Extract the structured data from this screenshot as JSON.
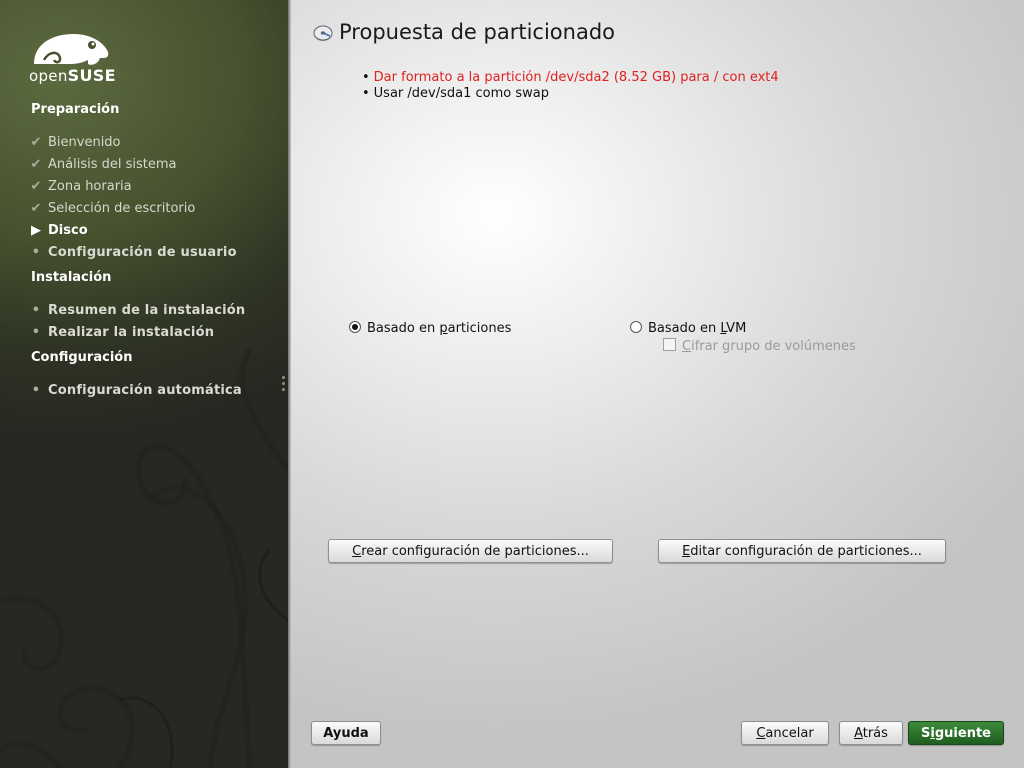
{
  "brand": {
    "logo_text_light": "open",
    "logo_text_bold": "SUSE"
  },
  "sidebar": {
    "sections": [
      {
        "title": "Preparación"
      },
      {
        "title": "Instalación"
      },
      {
        "title": "Configuración"
      }
    ],
    "steps": [
      {
        "label": "Bienvenido",
        "state": "done"
      },
      {
        "label": "Análisis del sistema",
        "state": "done"
      },
      {
        "label": "Zona horaria",
        "state": "done"
      },
      {
        "label": "Selección de escritorio",
        "state": "done"
      },
      {
        "label": "Disco",
        "state": "active"
      },
      {
        "label": "Configuración de usuario",
        "state": "pending"
      },
      {
        "label": "Resumen de la instalación",
        "state": "pending"
      },
      {
        "label": "Realizar la instalación",
        "state": "pending"
      },
      {
        "label": "Configuración automática",
        "state": "pending"
      }
    ]
  },
  "main": {
    "title": "Propuesta de particionado",
    "proposal": [
      {
        "text": "Dar formato a la partición /dev/sda2 (8.52 GB) para / con ext4",
        "color": "#e02020"
      },
      {
        "text": "Usar /dev/sda1 como swap",
        "color": "#111111"
      }
    ],
    "radio_partitions": {
      "before": "Basado en ",
      "key": "p",
      "after": "articiones",
      "selected": true
    },
    "radio_lvm": {
      "before": "Basado en ",
      "key": "L",
      "after": "VM",
      "selected": false
    },
    "check_encrypt": {
      "key": "C",
      "after": "ifrar grupo de volúmenes",
      "checked": false,
      "enabled": false
    },
    "btn_create": {
      "key": "C",
      "after": "rear configuración de particiones..."
    },
    "btn_edit": {
      "key": "E",
      "after": "ditar configuración de particiones..."
    }
  },
  "footer": {
    "help": "Ayuda",
    "cancel": {
      "key": "C",
      "after": "ancelar"
    },
    "back": {
      "key": "A",
      "after": "trás"
    },
    "next": {
      "before": "S",
      "key": "i",
      "after": "guiente"
    }
  },
  "colors": {
    "sidebar_dark": "#2f3424",
    "sidebar_light": "#5c6a3f",
    "accent_green": "#2a7a2a",
    "warning_red": "#e02020"
  }
}
